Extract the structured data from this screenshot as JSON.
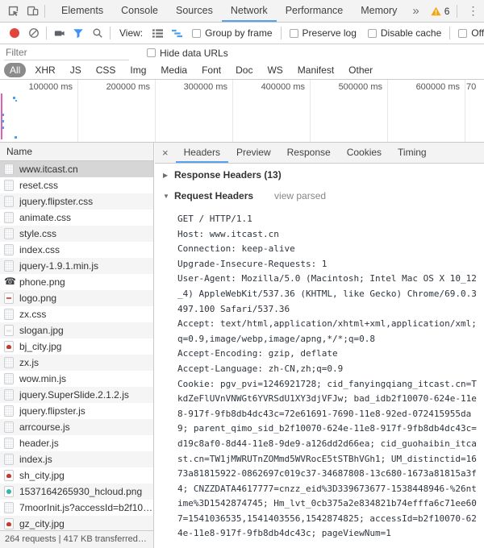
{
  "colors": {
    "accent_blue": "#55a2ef",
    "record_red": "#e2453c",
    "warning_orange": "#f2a60d",
    "funnel_blue": "#4192f3",
    "icon_gray": "#6e6e6e"
  },
  "titlebar": {
    "tabs": [
      {
        "label": "Elements"
      },
      {
        "label": "Console"
      },
      {
        "label": "Sources"
      },
      {
        "label": "Network",
        "active": true
      },
      {
        "label": "Performance"
      },
      {
        "label": "Memory"
      }
    ],
    "more_tabs_glyph": "»",
    "warning_count": "6",
    "menu_glyph": "⋮",
    "close_glyph": "✕"
  },
  "toolbar": {
    "view_label": "View:",
    "group_by_frame": "Group by frame",
    "preserve_log": "Preserve log",
    "disable_cache": "Disable cache",
    "offline": "Offli"
  },
  "filter_bar": {
    "placeholder": "Filter",
    "hide_data_urls": "Hide data URLs"
  },
  "type_filters": [
    {
      "label": "All",
      "active": true
    },
    {
      "label": "XHR"
    },
    {
      "label": "JS"
    },
    {
      "label": "CSS"
    },
    {
      "label": "Img"
    },
    {
      "label": "Media"
    },
    {
      "label": "Font"
    },
    {
      "label": "Doc"
    },
    {
      "label": "WS"
    },
    {
      "label": "Manifest"
    },
    {
      "label": "Other"
    }
  ],
  "overview": {
    "labels": [
      "100000 ms",
      "200000 ms",
      "300000 ms",
      "400000 ms",
      "500000 ms",
      "600000 ms",
      "70"
    ]
  },
  "requests": {
    "name_header": "Name",
    "rows": [
      {
        "name": "www.itcast.cn",
        "icon": "document",
        "selected": true
      },
      {
        "name": "reset.css",
        "icon": "document"
      },
      {
        "name": "jquery.flipster.css",
        "icon": "document"
      },
      {
        "name": "animate.css",
        "icon": "document"
      },
      {
        "name": "style.css",
        "icon": "document"
      },
      {
        "name": "index.css",
        "icon": "document"
      },
      {
        "name": "jquery-1.9.1.min.js",
        "icon": "document"
      },
      {
        "name": "phone.png",
        "icon": "phone"
      },
      {
        "name": "logo.png",
        "icon": "logo-image"
      },
      {
        "name": "zx.css",
        "icon": "document"
      },
      {
        "name": "slogan.jpg",
        "icon": "slogan-image"
      },
      {
        "name": "bj_city.jpg",
        "icon": "city-image"
      },
      {
        "name": "zx.js",
        "icon": "document"
      },
      {
        "name": "wow.min.js",
        "icon": "document"
      },
      {
        "name": "jquery.SuperSlide.2.1.2.js",
        "icon": "document"
      },
      {
        "name": "jquery.flipster.js",
        "icon": "document"
      },
      {
        "name": "arrcourse.js",
        "icon": "document"
      },
      {
        "name": "header.js",
        "icon": "document"
      },
      {
        "name": "index.js",
        "icon": "document"
      },
      {
        "name": "sh_city.jpg",
        "icon": "city-image"
      },
      {
        "name": "1537164265930_hcloud.png",
        "icon": "hcloud-image"
      },
      {
        "name": "7moorInit.js?accessId=b2f10…",
        "icon": "document"
      },
      {
        "name": "gz_city.jpg",
        "icon": "city-image"
      }
    ],
    "summary": "264 requests | 417 KB transferred…"
  },
  "panel": {
    "close_glyph": "×",
    "tabs": [
      {
        "label": "Headers",
        "active": true
      },
      {
        "label": "Preview"
      },
      {
        "label": "Response"
      },
      {
        "label": "Cookies"
      },
      {
        "label": "Timing"
      }
    ],
    "response_headers": {
      "collapse_glyph": "▶",
      "label": "Response Headers (13)"
    },
    "request_headers": {
      "collapse_glyph": "▼",
      "label": "Request Headers",
      "view_parsed": "view parsed"
    },
    "request_header_lines": [
      "GET / HTTP/1.1",
      "Host: www.itcast.cn",
      "Connection: keep-alive",
      "Upgrade-Insecure-Requests: 1",
      "User-Agent: Mozilla/5.0 (Macintosh; Intel Mac OS X 10_12",
      "_4) AppleWebKit/537.36 (KHTML, like Gecko) Chrome/69.0.3",
      "497.100 Safari/537.36",
      "Accept: text/html,application/xhtml+xml,application/xml;",
      "q=0.9,image/webp,image/apng,*/*;q=0.8",
      "Accept-Encoding: gzip, deflate",
      "Accept-Language: zh-CN,zh;q=0.9",
      "Cookie: pgv_pvi=1246921728; cid_fanyingqiang_itcast.cn=T",
      "kdZeFlUVnVNWGt6YVRSdU1XY3djVFJw; bad_idb2f10070-624e-11e",
      "8-917f-9fb8db4dc43c=72e61691-7690-11e8-92ed-072415955da",
      "9; parent_qimo_sid_b2f10070-624e-11e8-917f-9fb8db4dc43c=",
      "d19c8af0-8d44-11e8-9de9-a126dd2d66ea; cid_guohaibin_itca",
      "st.cn=TW1jMWRUTnZOMmd5WVRocE5tSTBhVGh1; UM_distinctid=16",
      "73a81815922-0862697c019c37-34687808-13c680-1673a81815a3f",
      "4; CNZZDATA4617777=cnzz_eid%3D339673677-1538448946-%26nt",
      "ime%3D1542874745; Hm_lvt_0cb375a2e834821b74efffa6c71ee60",
      "7=1541036535,1541403556,1542874825; accessId=b2f10070-62",
      "4e-11e8-917f-9fb8db4dc43c; pageViewNum=1"
    ]
  }
}
